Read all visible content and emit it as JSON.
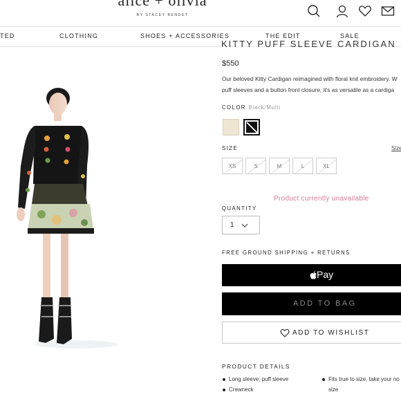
{
  "brand": {
    "name": "alice + olivia",
    "tagline": "BY STACEY BENDET"
  },
  "header_icons": [
    "search-icon",
    "account-icon",
    "wishlist-heart-icon",
    "mail-icon"
  ],
  "nav": {
    "items": [
      {
        "label": "TED"
      },
      {
        "label": "CLOTHING"
      },
      {
        "label": "SHOES + ACCESSORIES"
      },
      {
        "label": "THE EDIT"
      },
      {
        "label": "SALE"
      }
    ]
  },
  "product": {
    "name": "KITTY PUFF SLEEVE CARDIGAN",
    "price": "$550",
    "description_line1": "Our beloved Kitty Cardigan reimagined with floral knit embroidery. W",
    "description_line2": "puff sleeves and a button front closure, it's as versatile as a cardiga",
    "color_label": "COLOR",
    "color_value": "Black/Multi",
    "swatches": [
      {
        "name": "cream",
        "color": "#ede6d2"
      },
      {
        "name": "black",
        "color": "#111111"
      }
    ],
    "size_label": "SIZE",
    "size_guide": "Size",
    "sizes": [
      "XS",
      "S",
      "M",
      "L",
      "XL"
    ],
    "availability": "Product currently unavailable",
    "quantity_label": "QUANTITY",
    "quantity_value": "1",
    "shipping_note": "FREE GROUND SHIPPING + RETURNS",
    "apple_pay_label": "Pay",
    "add_to_bag_label": "ADD TO BAG",
    "wishlist_label": "ADD TO WISHLIST",
    "details_heading": "PRODUCT DETAILS",
    "details": [
      "Long sleeve; puff sleeve",
      "Crewneck",
      "Fits true to size, take your no",
      "size"
    ]
  },
  "colors": {
    "accent_unavailable": "#d07a97",
    "button_black": "#000000",
    "add_to_bag_text": "#8a8a8a"
  }
}
